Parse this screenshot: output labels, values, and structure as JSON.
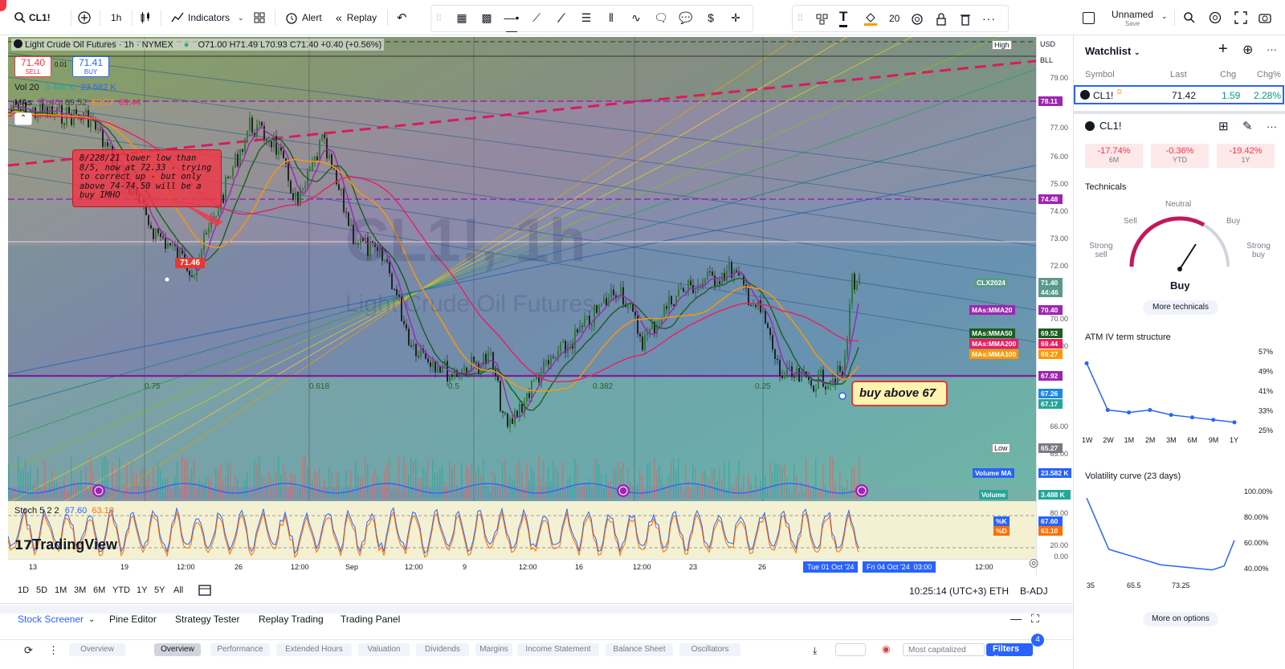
{
  "header": {
    "symbol": "CL1!",
    "interval": "1h",
    "indicators_label": "Indicators",
    "alert_label": "Alert",
    "replay_label": "Replay",
    "font_size_value": "20",
    "layout_name": "Unnamed",
    "layout_sub": "Save"
  },
  "chart": {
    "title": "Light Crude Oil Futures · 1h · NYMEX",
    "ohlc": "O71.00 H71.49 L70.93 C71.40 +0.40 (+0.56%)",
    "sell_price": "71.40",
    "sell_label": "SELL",
    "mid_price": "0.01",
    "buy_price": "71.41",
    "buy_label": "BUY",
    "vol_label": "Vol 20",
    "vol_values": [
      "3.488 K",
      "23.582 K"
    ],
    "mas_label": "MAs",
    "mas_values": [
      "70.40",
      "69.52",
      "69.27",
      "69.44"
    ],
    "annotation": "8/228/21 lower low than 8/5, now at 72.33 - trying to correct up - but only above 74-74.50 will be a buy IMHO",
    "price_flag": "71.46",
    "buy_callout": "buy above 67",
    "watermark_symbol": "CL1!, 1h",
    "watermark_name": "Light Crude Oil Futures",
    "fib_labels": [
      "0.75",
      "0.618",
      "0.5",
      "0.382",
      "0.25"
    ],
    "stoch_label": "Stoch 5 2 2",
    "stoch_values": [
      "67.60",
      "63.10"
    ],
    "brand": "TradingView",
    "currency": "USD",
    "bll": "BLL",
    "high_label": "High",
    "low_label": "Low",
    "price_ticks": [
      "79.00",
      "77.00",
      "76.00",
      "75.00",
      "74.00",
      "73.00",
      "72.00",
      "70.00",
      "69.00",
      "66.00",
      "65.00"
    ],
    "stoch_ticks": [
      "80.00",
      "20.00",
      "0.00"
    ],
    "price_labels": [
      {
        "text": "78.11",
        "color": "#9c27b0"
      },
      {
        "text": "74.48",
        "color": "#9c27b0"
      },
      {
        "text": "CLX2024",
        "color": "#5b9a8b"
      },
      {
        "text": "71.40",
        "color": "#5b9a8b"
      },
      {
        "text": "44:46",
        "color": "#5b9a8b"
      },
      {
        "text": "MAs:MMA20",
        "color": "#9c27b0"
      },
      {
        "text": "70.40",
        "color": "#9c27b0"
      },
      {
        "text": "MAs:MMA50",
        "color": "#1b5e20"
      },
      {
        "text": "69.52",
        "color": "#1b5e20"
      },
      {
        "text": "MAs:MMA200",
        "color": "#e91e63"
      },
      {
        "text": "69.44",
        "color": "#e91e63"
      },
      {
        "text": "MAs:MMA100",
        "color": "#ff9800"
      },
      {
        "text": "69.27",
        "color": "#ff9800"
      },
      {
        "text": "67.92",
        "color": "#9c27b0"
      },
      {
        "text": "67.26",
        "color": "#1e88e5"
      },
      {
        "text": "67.17",
        "color": "#26a69a"
      },
      {
        "text": "65.27",
        "color": "#787b86"
      },
      {
        "text": "Volume MA",
        "color": "#2962ff"
      },
      {
        "text": "23.582 K",
        "color": "#2962ff"
      },
      {
        "text": "Volume",
        "color": "#26a69a"
      },
      {
        "text": "3.488 K",
        "color": "#26a69a"
      },
      {
        "text": "%K",
        "color": "#2962ff"
      },
      {
        "text": "67.60",
        "color": "#2962ff"
      },
      {
        "text": "%D",
        "color": "#ff6d00"
      },
      {
        "text": "63.10",
        "color": "#ff6d00"
      }
    ],
    "time_ticks": [
      "13",
      "19",
      "12:00",
      "26",
      "12:00",
      "Sep",
      "12:00",
      "9",
      "12:00",
      "16",
      "12:00",
      "23",
      "26",
      "12:00"
    ],
    "cursor_date1": "Tue 01 Oct '24",
    "cursor_date2": "Fri 04 Oct '24",
    "cursor_time": "03:00"
  },
  "timeframes": [
    "1D",
    "5D",
    "1M",
    "3M",
    "6M",
    "YTD",
    "1Y",
    "5Y",
    "All"
  ],
  "status": {
    "clock": "10:25:14 (UTC+3)",
    "session": "ETH",
    "adj": "B-ADJ"
  },
  "bottom_tabs": [
    "Stock Screener",
    "Pine Editor",
    "Strategy Tester",
    "Replay Trading",
    "Trading Panel"
  ],
  "screener_tabs": [
    "Overview",
    "Overview",
    "Performance",
    "Extended Hours",
    "Valuation",
    "Dividends",
    "Margins",
    "Income Statement",
    "Balance Sheet",
    "Oscillators"
  ],
  "screener_sort": "Most capitalized",
  "filters_label": "Filters",
  "filters_count": "4",
  "watchlist": {
    "title": "Watchlist",
    "cols": [
      "Symbol",
      "Last",
      "Chg",
      "Chg%"
    ],
    "rows": [
      {
        "symbol": "CL1!",
        "last": "71.42",
        "chg": "1.59",
        "chgp": "2.28%"
      }
    ]
  },
  "details": {
    "symbol": "CL1!",
    "perf": [
      {
        "v": "-17.74%",
        "p": "6M"
      },
      {
        "v": "-0.36%",
        "p": "YTD"
      },
      {
        "v": "-19.42%",
        "p": "1Y"
      }
    ],
    "technicals_title": "Technicals",
    "gauge": {
      "neutral": "Neutral",
      "sell": "Sell",
      "buy": "Buy",
      "strong_sell": "Strong sell",
      "strong_buy": "Strong buy",
      "result": "Buy"
    },
    "more_technicals": "More technicals",
    "atm_title": "ATM IV term structure",
    "atm_y": [
      "57%",
      "49%",
      "41%",
      "33%",
      "25%"
    ],
    "atm_x": [
      "1W",
      "2W",
      "1M",
      "2M",
      "3M",
      "6M",
      "9M",
      "1Y"
    ],
    "atm_values": [
      52,
      33,
      32,
      33,
      31,
      30,
      29,
      28
    ],
    "vol_title": "Volatility curve (23 days)",
    "vol_y": [
      "100.00%",
      "80.00%",
      "60.00%",
      "40.00%"
    ],
    "vol_x": [
      "35",
      "65.5",
      "73.25"
    ],
    "vol_values": [
      [
        0,
        95
      ],
      [
        0.15,
        55
      ],
      [
        0.5,
        43
      ],
      [
        0.85,
        39
      ],
      [
        0.93,
        42
      ],
      [
        1.0,
        62
      ]
    ],
    "more_options": "More on options"
  }
}
